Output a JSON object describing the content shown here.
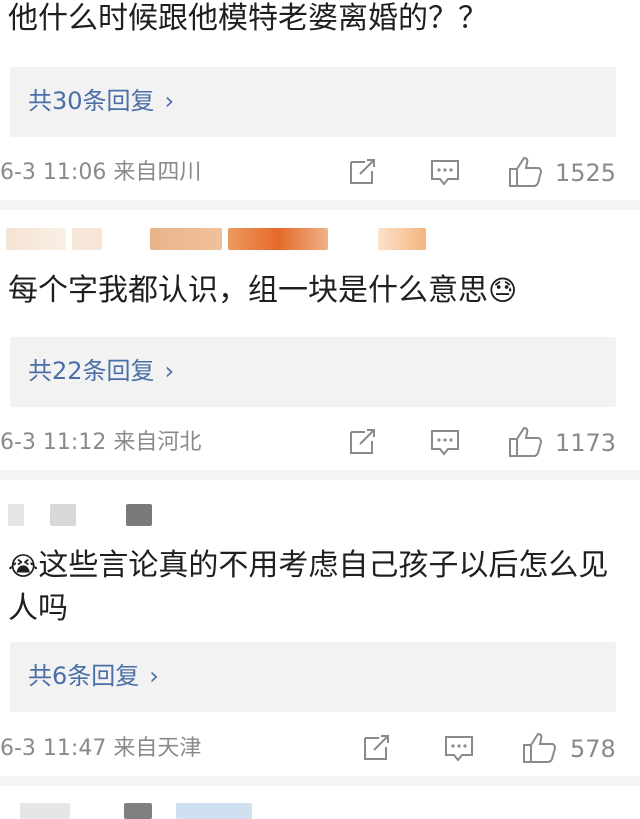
{
  "comments": [
    {
      "text": "他什么时候跟他模特老婆离婚的？？",
      "reply_label": "共30条回复",
      "meta": "6-3 11:06  来自四川",
      "likes": "1525",
      "icons": [
        "share-icon",
        "comment-icon",
        "like-icon"
      ]
    },
    {
      "text": "每个字我都认识，组一块是什么意思",
      "emoji": "😓",
      "reply_label": "共22条回复",
      "meta": "6-3 11:12  来自河北",
      "likes": "1173",
      "icons": [
        "share-icon",
        "comment-icon",
        "like-icon"
      ]
    },
    {
      "emoji": "😭",
      "text": "这些言论真的不用考虑自己孩子以后怎么见人吗",
      "reply_label": "共6条回复",
      "meta": "6-3 11:47  来自天津",
      "likes": "578",
      "icons": [
        "share-icon",
        "comment-icon",
        "like-icon"
      ]
    }
  ],
  "colors": {
    "link": "#4a6ea8",
    "meta_gray": "#8a8a8a",
    "reply_bg": "#f2f2f2"
  }
}
